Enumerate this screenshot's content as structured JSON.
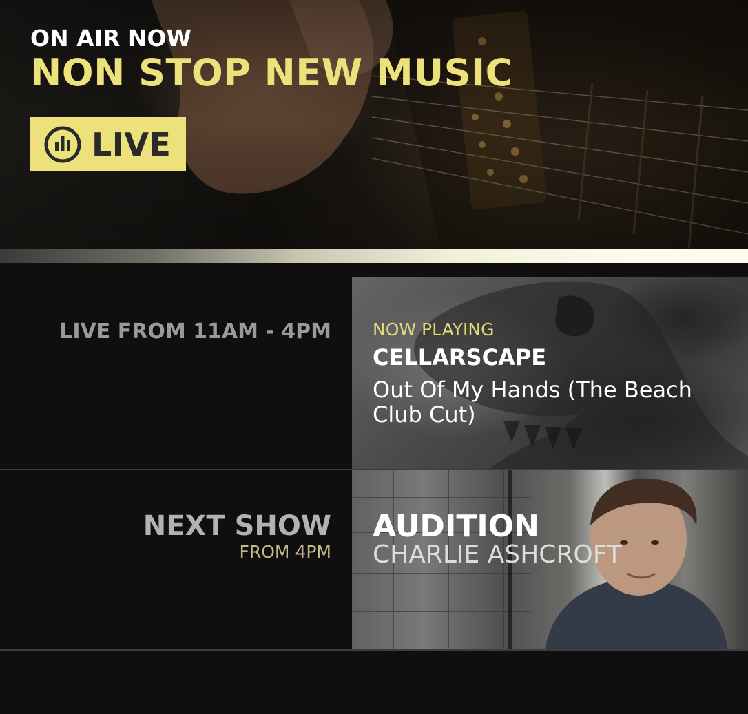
{
  "hero": {
    "eyebrow": "ON AIR NOW",
    "title": "NON STOP NEW MUSIC",
    "live_button": {
      "label": "LIVE",
      "icon": "equalizer-icon"
    }
  },
  "now": {
    "time_label": "LIVE FROM 11AM - 4PM",
    "eyebrow": "NOW PLAYING",
    "artist": "CELLARSCAPE",
    "track": "Out Of My Hands (The Beach Club Cut)"
  },
  "next": {
    "label": "NEXT SHOW",
    "time": "FROM 4PM",
    "show_title": "AUDITION",
    "host": "CHARLIE ASHCROFT"
  },
  "colors": {
    "accent": "#ece17a",
    "background": "#0f0f0f",
    "separator": "#3d3d3d"
  }
}
